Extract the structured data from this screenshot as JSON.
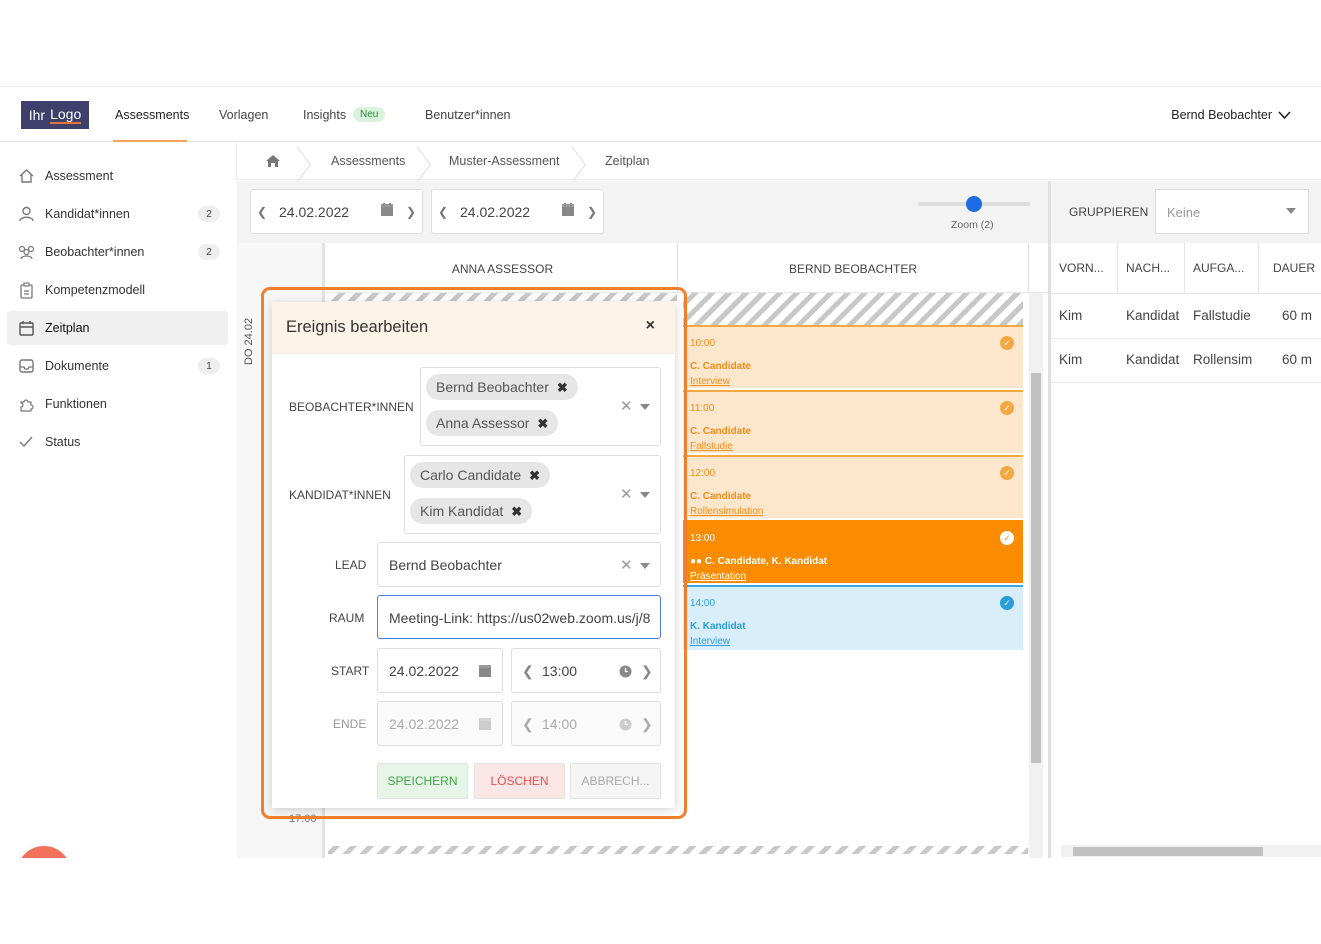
{
  "logo": {
    "part1": "Ihr",
    "part2": "Logo"
  },
  "nav": {
    "assessments": "Assessments",
    "vorlagen": "Vorlagen",
    "insights": "Insights",
    "insights_badge": "Neu",
    "benutzer": "Benutzer*innen",
    "user": "Bernd Beobachter"
  },
  "sidebar": {
    "items": [
      {
        "label": "Assessment",
        "icon": "home-icon",
        "count": ""
      },
      {
        "label": "Kandidat*innen",
        "icon": "user-icon",
        "count": "2"
      },
      {
        "label": "Beobachter*innen",
        "icon": "users-icon",
        "count": "2"
      },
      {
        "label": "Kompetenzmodell",
        "icon": "clipboard-icon",
        "count": ""
      },
      {
        "label": "Zeitplan",
        "icon": "calendar-icon",
        "count": ""
      },
      {
        "label": "Dokumente",
        "icon": "inbox-icon",
        "count": "1"
      },
      {
        "label": "Funktionen",
        "icon": "puzzle-icon",
        "count": ""
      },
      {
        "label": "Status",
        "icon": "check-icon",
        "count": ""
      }
    ],
    "help": "?"
  },
  "breadcrumb": {
    "assessments": "Assessments",
    "muster": "Muster-Assessment",
    "zeitplan": "Zeitplan"
  },
  "toolbar": {
    "date_from": "24.02.2022",
    "date_to": "24.02.2022",
    "zoom": "Zoom (2)"
  },
  "calendar": {
    "columns": [
      "ANNA ASSESSOR",
      "BERND BEOBACHTER"
    ],
    "day": "DO 24.02",
    "last_time": "17:00",
    "events": [
      {
        "time": "10:00",
        "who": "C. Candidate",
        "what": "Interview"
      },
      {
        "time": "11:00",
        "who": "C. Candidate",
        "what": "Fallstudie"
      },
      {
        "time": "12:00",
        "who": "C. Candidate",
        "what": "Rollensimulation"
      },
      {
        "time": "13:00",
        "who": "C. Candidate, K. Kandidat",
        "what": "Präsentation"
      },
      {
        "time": "14:00",
        "who": "K. Kandidat",
        "what": "Interview"
      }
    ]
  },
  "grid": {
    "group_label": "GRUPPIEREN",
    "group_placeholder": "Keine",
    "headers": [
      "VORN...",
      "NACH...",
      "AUFGA...",
      "DAUER"
    ],
    "rows": [
      [
        "Kim",
        "Kandidat",
        "Fallstudie",
        "60 m"
      ],
      [
        "Kim",
        "Kandidat",
        "Rollensim",
        "60 m"
      ]
    ]
  },
  "modal": {
    "title": "Ereignis bearbeiten",
    "close": "×",
    "observers_label": "BEOBACHTER*INNEN",
    "observers": [
      "Bernd Beobachter",
      "Anna Assessor"
    ],
    "candidates_label": "KANDIDAT*INNEN",
    "candidates": [
      "Carlo Candidate",
      "Kim Kandidat"
    ],
    "lead_label": "LEAD",
    "lead_value": "Bernd Beobachter",
    "room_label": "RAUM",
    "room_value": "Meeting-Link: https://us02web.zoom.us/j/8",
    "start_label": "START",
    "start_date": "24.02.2022",
    "start_time": "13:00",
    "end_label": "ENDE",
    "end_date": "24.02.2022",
    "end_time": "14:00",
    "save": "SPEICHERN",
    "delete": "LÖSCHEN",
    "cancel": "ABBRECH..."
  },
  "colors": {
    "accent": "#f07e2a",
    "event": "#fde7cc",
    "selected": "#fb8c00",
    "blue": "#d8eefb"
  }
}
